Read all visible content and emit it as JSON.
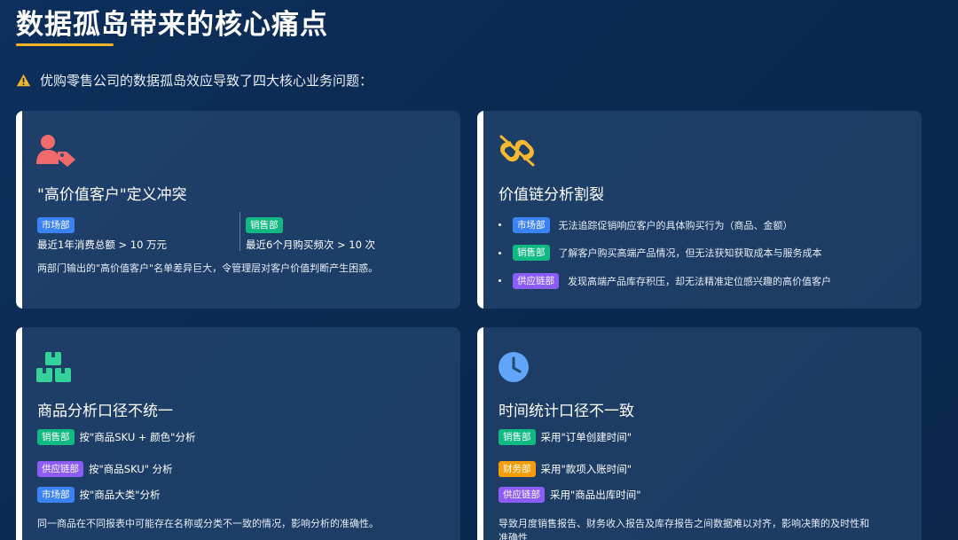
{
  "header": {
    "title": "数据孤岛带来的核心痛点",
    "intro": "优购零售公司的数据孤岛效应导致了四大核心业务问题："
  },
  "colors": {
    "accent": "#f0b429",
    "card_bg": "#2e4e78",
    "blue": "#3b82f6",
    "green": "#10b981",
    "purple": "#8b5cf6",
    "orange": "#f59e0b"
  },
  "cards": [
    {
      "icon": "user-tag-icon",
      "title": "\"高价值客户\"定义冲突",
      "left": {
        "tag": "市场部",
        "text": "最近1年消费总额 > 10  万元"
      },
      "right": {
        "tag": "销售部",
        "text": "最近6个月购买频次 > 10  次"
      },
      "desc": "两部门输出的\"高价值客户\"名单差异巨大，令管理层对客户价值判断产生困惑。"
    },
    {
      "icon": "broken-link-icon",
      "title": "价值链分析割裂",
      "items": [
        {
          "tag": "市场部",
          "text": "无法追踪促销响应客户的具体购买行为（商品、金额）"
        },
        {
          "tag": "销售部",
          "text": "了解客户购买高端产品情况，但无法获知获取成本与服务成本"
        },
        {
          "tag": "供应链部",
          "text": "发现高端产品库存积压，却无法精准定位感兴趣的高价值客户"
        }
      ]
    },
    {
      "icon": "boxes-icon",
      "title": "商品分析口径不统一",
      "rows": [
        {
          "tag": "销售部",
          "text": "按\"商品SKU +    颜色\"分析"
        },
        {
          "tag": "供应链部",
          "text": "按\"商品SKU\"  分析"
        },
        {
          "tag": "市场部",
          "text": "按\"商品大类\"分析"
        }
      ],
      "desc": "同一商品在不同报表中可能存在名称或分类不一致的情况，影响分析的准确性。"
    },
    {
      "icon": "clock-icon",
      "title": "时间统计口径不一致",
      "rows": [
        {
          "tag": "销售部",
          "text": "采用\"订单创建时间\""
        },
        {
          "tag": "财务部",
          "text": "采用\"款项入账时间\""
        },
        {
          "tag": "供应链部",
          "text": "采用\"商品出库时间\""
        }
      ],
      "desc": "导致月度销售报告、财务收入报告及库存报告之间数据难以对齐，影响决策的及时性和",
      "desc2": "准确性"
    }
  ]
}
